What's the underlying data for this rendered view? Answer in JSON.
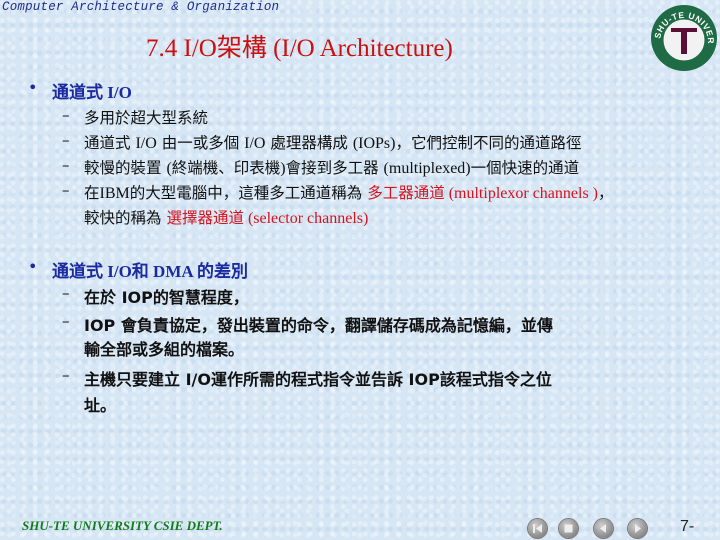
{
  "header": {
    "course": "Computer Architecture & Organization"
  },
  "title": "7.4 I/O架構 (I/O Architecture)",
  "logo": {
    "text": "SHU-TE UNIVERSITY",
    "letter": "T",
    "ring_color": "#1f6b45",
    "letter_color": "#5a1035"
  },
  "sections": [
    {
      "heading": "通道式 I/O",
      "items": [
        {
          "parts": [
            {
              "t": "多用於超大型系統"
            }
          ]
        },
        {
          "parts": [
            {
              "t": "通道式 "
            },
            {
              "t": "I/O",
              "s": 1
            },
            {
              "t": " 由一或多個 "
            },
            {
              "t": "I/O",
              "s": 1
            },
            {
              "t": " 處理器構成 "
            },
            {
              "t": "(IOPs)",
              "s": 1
            },
            {
              "t": "，它們控制不同的通道路徑"
            }
          ]
        },
        {
          "parts": [
            {
              "t": "較慢的裝置 "
            },
            {
              "t": "(",
              "s": 1
            },
            {
              "t": "終端機、印表機"
            },
            {
              "t": ")",
              "s": 1
            },
            {
              "t": "會接到多工器 "
            },
            {
              "t": "(multiplexed)",
              "s": 1
            },
            {
              "t": "一個快速的通道"
            }
          ]
        },
        {
          "parts": [
            {
              "t": "在"
            },
            {
              "t": "IBM",
              "s": 1
            },
            {
              "t": "的大型電腦中，這種多工通道稱為 "
            },
            {
              "t": "多工器通道",
              "r": 1
            },
            {
              "t": " (multiplexor channels )",
              "r": 1,
              "s": 1
            },
            {
              "t": "，"
            }
          ],
          "cont": [
            {
              "t": "較快的稱為 "
            },
            {
              "t": "選擇器通道",
              "r": 1
            },
            {
              "t": " (selector channels)",
              "r": 1,
              "s": 1
            }
          ]
        }
      ]
    },
    {
      "heading": "通道式 I/O和 DMA 的差別",
      "items": [
        {
          "parts": [
            {
              "t": "在於 IOP的智慧程度，"
            }
          ]
        },
        {
          "parts": [
            {
              "t": "IOP 會負責協定，發出裝置的命令，翻譯儲存碼成為記憶編，並傳"
            }
          ],
          "cont": [
            {
              "t": "輸全部或多組的檔案。"
            }
          ]
        },
        {
          "parts": [
            {
              "t": "主機只要建立 I/O運作所需的程式指令並告訴  IOP該程式指令之位"
            }
          ],
          "cont": [
            {
              "t": "址。"
            }
          ]
        }
      ]
    }
  ],
  "footer": {
    "text": "SHU-TE UNIVERSITY  CSIE DEPT."
  },
  "nav": {
    "buttons": [
      "first",
      "end",
      "previous",
      "next"
    ],
    "page": "7-"
  }
}
